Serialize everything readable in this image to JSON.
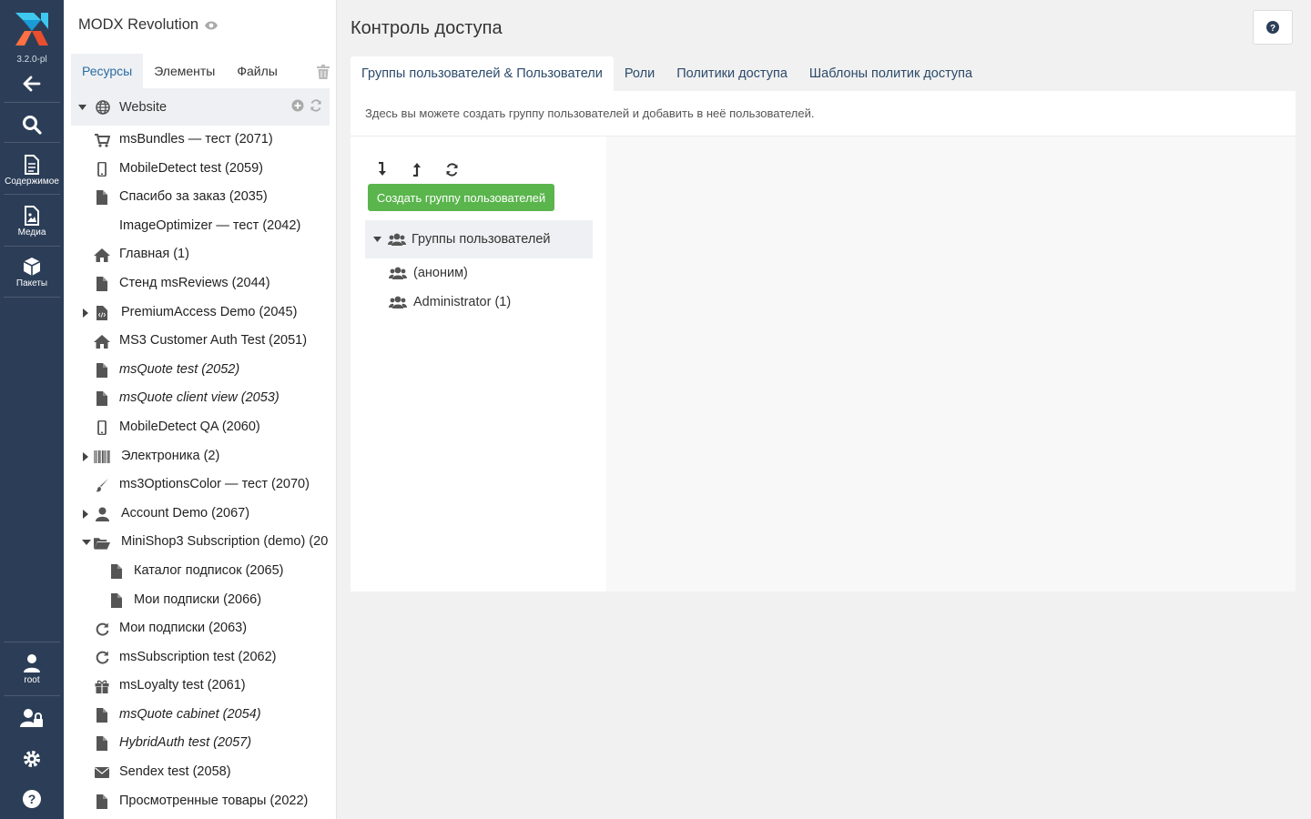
{
  "app": {
    "version": "3.2.0-pl",
    "site_name": "MODX Revolution"
  },
  "rail": {
    "content_label": "Содержимое",
    "media_label": "Медиа",
    "packages_label": "Пакеты",
    "user_label": "root"
  },
  "tree": {
    "tabs": [
      "Ресурсы",
      "Элементы",
      "Файлы"
    ],
    "root_label": "Website",
    "items": [
      {
        "label": "msBundles — тест (2071)",
        "icon": "cart-icon"
      },
      {
        "label": "MobileDetect test (2059)",
        "icon": "mobile-icon"
      },
      {
        "label": "Спасибо за заказ (2035)",
        "icon": "file-icon"
      },
      {
        "label": "ImageOptimizer — тест (2042)",
        "icon": "none"
      },
      {
        "label": "Главная (1)",
        "icon": "home-icon"
      },
      {
        "label": "Стенд msReviews (2044)",
        "icon": "file-icon"
      },
      {
        "label": "PremiumAccess Demo (2045)",
        "icon": "file-code-icon",
        "collapsed": true
      },
      {
        "label": "MS3 Customer Auth Test (2051)",
        "icon": "home-icon"
      },
      {
        "label": "msQuote test (2052)",
        "icon": "file-icon",
        "italic": true
      },
      {
        "label": "msQuote client view (2053)",
        "icon": "file-icon",
        "italic": true
      },
      {
        "label": "MobileDetect QA (2060)",
        "icon": "mobile-icon"
      },
      {
        "label": "Электроника (2)",
        "icon": "barcode-icon",
        "collapsed": true
      },
      {
        "label": "ms3OptionsColor — тест (2070)",
        "icon": "brush-icon"
      },
      {
        "label": "Account Demo (2067)",
        "icon": "user-icon",
        "collapsed": true
      },
      {
        "label": "MiniShop3 Subscription (demo) (20",
        "icon": "folder-open-icon",
        "expanded": true
      },
      {
        "label": "Каталог подписок (2065)",
        "icon": "file-icon",
        "level": 2
      },
      {
        "label": "Мои подписки (2066)",
        "icon": "file-icon",
        "level": 2
      },
      {
        "label": "Мои подписки (2063)",
        "icon": "refresh-icon"
      },
      {
        "label": "msSubscription test (2062)",
        "icon": "refresh-icon"
      },
      {
        "label": "msLoyalty test (2061)",
        "icon": "gift-icon"
      },
      {
        "label": "msQuote cabinet (2054)",
        "icon": "file-icon",
        "italic": true
      },
      {
        "label": "HybridAuth test (2057)",
        "icon": "file-icon",
        "italic": true
      },
      {
        "label": "Sendex test (2058)",
        "icon": "envelope-icon"
      },
      {
        "label": "Просмотренные товары (2022)",
        "icon": "file-icon"
      }
    ]
  },
  "main": {
    "title": "Контроль доступа",
    "tabs": [
      "Группы пользователей & Пользователи",
      "Роли",
      "Политики доступа",
      "Шаблоны политик доступа"
    ],
    "description": "Здесь вы можете создать группу пользователей и добавить в неё пользователей.",
    "create_button": "Создать группу пользователей",
    "groups_root": "Группы пользователей",
    "groups": [
      "(аноним)",
      "Administrator (1)"
    ]
  },
  "colors": {
    "rail": "#2c3e57",
    "accent_green": "#5ab54c",
    "link": "#2b4a6b"
  }
}
